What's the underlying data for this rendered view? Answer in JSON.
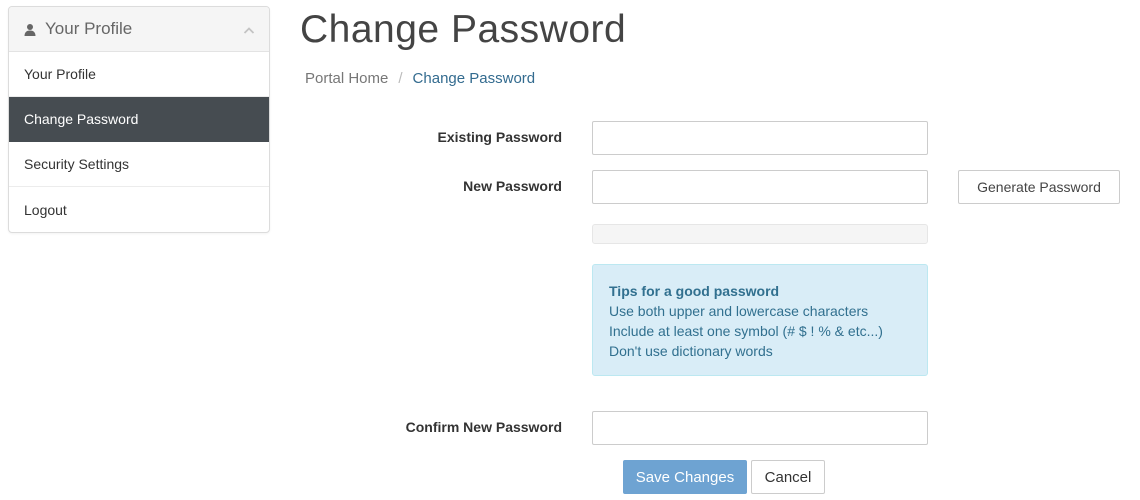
{
  "sidebar": {
    "header": "Your Profile",
    "items": [
      {
        "label": "Your Profile",
        "active": false
      },
      {
        "label": "Change Password",
        "active": true
      },
      {
        "label": "Security Settings",
        "active": false
      },
      {
        "label": "Logout",
        "active": false
      }
    ]
  },
  "page": {
    "title": "Change Password",
    "breadcrumb": {
      "home": "Portal Home",
      "separator": "/",
      "current": "Change Password"
    }
  },
  "form": {
    "existing_password_label": "Existing Password",
    "existing_password_value": "",
    "new_password_label": "New Password",
    "new_password_value": "",
    "generate_button": "Generate Password",
    "strength_percent": 0,
    "tips": {
      "title": "Tips for a good password",
      "lines": [
        "Use both upper and lowercase characters",
        "Include at least one symbol (# $ ! % & etc...)",
        "Don't use dictionary words"
      ]
    },
    "confirm_password_label": "Confirm New Password",
    "confirm_password_value": "",
    "save_button": "Save Changes",
    "cancel_button": "Cancel"
  },
  "colors": {
    "sidebar_active_bg": "#464c51",
    "tips_bg": "#d9edf7",
    "tips_text": "#31708f",
    "primary_button": "#6ea3d2",
    "breadcrumb_current": "#336b8f"
  },
  "icons": {
    "sidebar_header": "user-icon",
    "sidebar_collapse": "chevron-up-icon"
  }
}
